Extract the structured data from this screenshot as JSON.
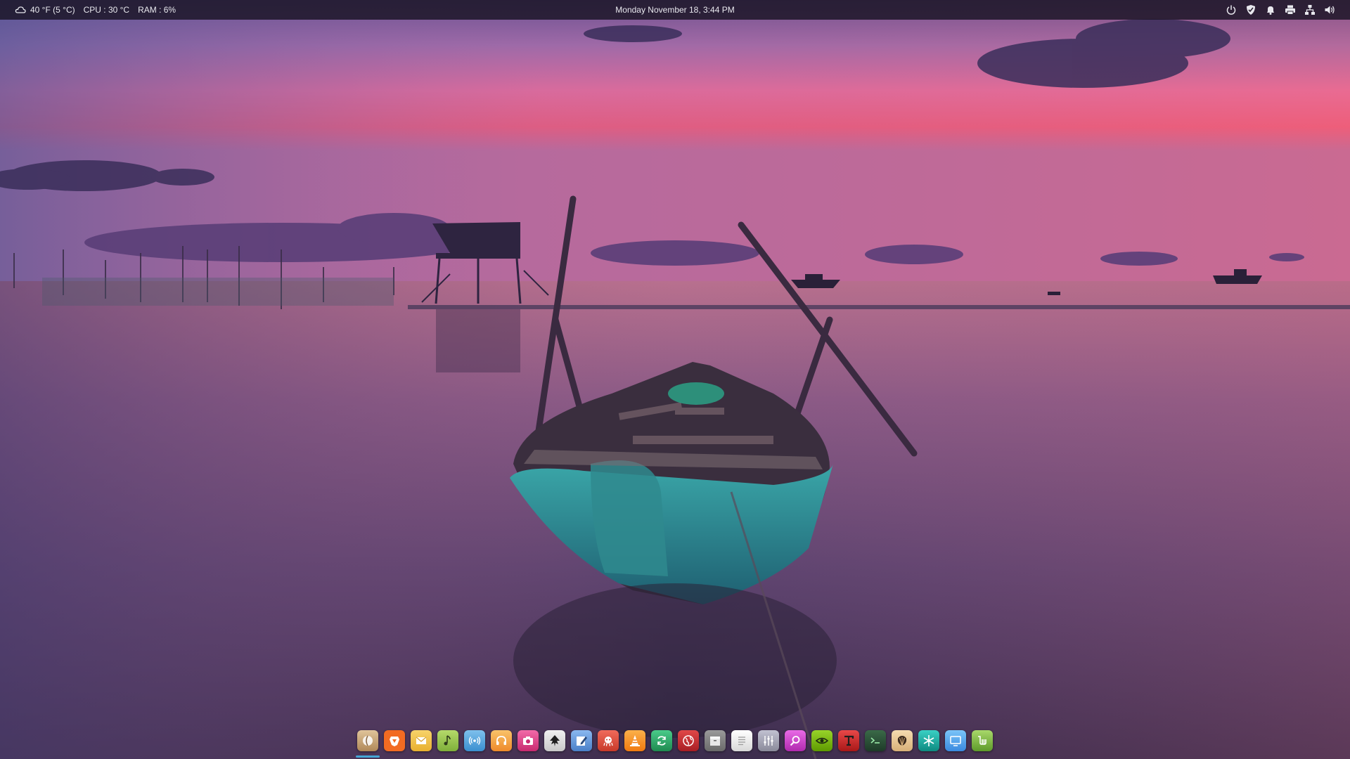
{
  "topbar": {
    "weather": "40 °F (5 °C)",
    "cpu": "CPU : 30 °C",
    "ram": "RAM : 6%",
    "datetime": "Monday November 18, 3:44 PM"
  },
  "tray_icons": [
    "power-icon",
    "shield-icon",
    "bell-icon",
    "printer-icon",
    "network-icon",
    "volume-icon"
  ],
  "dock": {
    "apps": [
      {
        "name": "finder-app",
        "color": "#c9a57a"
      },
      {
        "name": "brave-browser-app",
        "color": "#f26b22"
      },
      {
        "name": "mail-app",
        "color": "#f3c44b"
      },
      {
        "name": "music-app",
        "color": "#8bc34a"
      },
      {
        "name": "podcasts-app",
        "color": "#4aa3df"
      },
      {
        "name": "headphones-app",
        "color": "#f5a742"
      },
      {
        "name": "camera-app",
        "color": "#e8488a"
      },
      {
        "name": "inkscape-app",
        "color": "#2e2e2e"
      },
      {
        "name": "text-editor-app",
        "color": "#5b8fd6"
      },
      {
        "name": "gitkraken-app",
        "color": "#e24c3a"
      },
      {
        "name": "vlc-app",
        "color": "#f58a1f"
      },
      {
        "name": "sync-app",
        "color": "#2ea36a"
      },
      {
        "name": "web-browser-app",
        "color": "#c6262e"
      },
      {
        "name": "archive-app",
        "color": "#8a8a8a"
      },
      {
        "name": "notes-app",
        "color": "#e8e8e8"
      },
      {
        "name": "equalizer-app",
        "color": "#a5a5b5"
      },
      {
        "name": "search-app",
        "color": "#d43fd1"
      },
      {
        "name": "nvidia-app",
        "color": "#76b900"
      },
      {
        "name": "font-manager-app",
        "color": "#c8282e"
      },
      {
        "name": "terminal-app",
        "color": "#2f5a3a"
      },
      {
        "name": "shell-app",
        "color": "#e8c99a"
      },
      {
        "name": "settings-app",
        "color": "#1eb3a8"
      },
      {
        "name": "display-app",
        "color": "#4ea8ec"
      },
      {
        "name": "mint-app",
        "color": "#86be43"
      }
    ]
  }
}
